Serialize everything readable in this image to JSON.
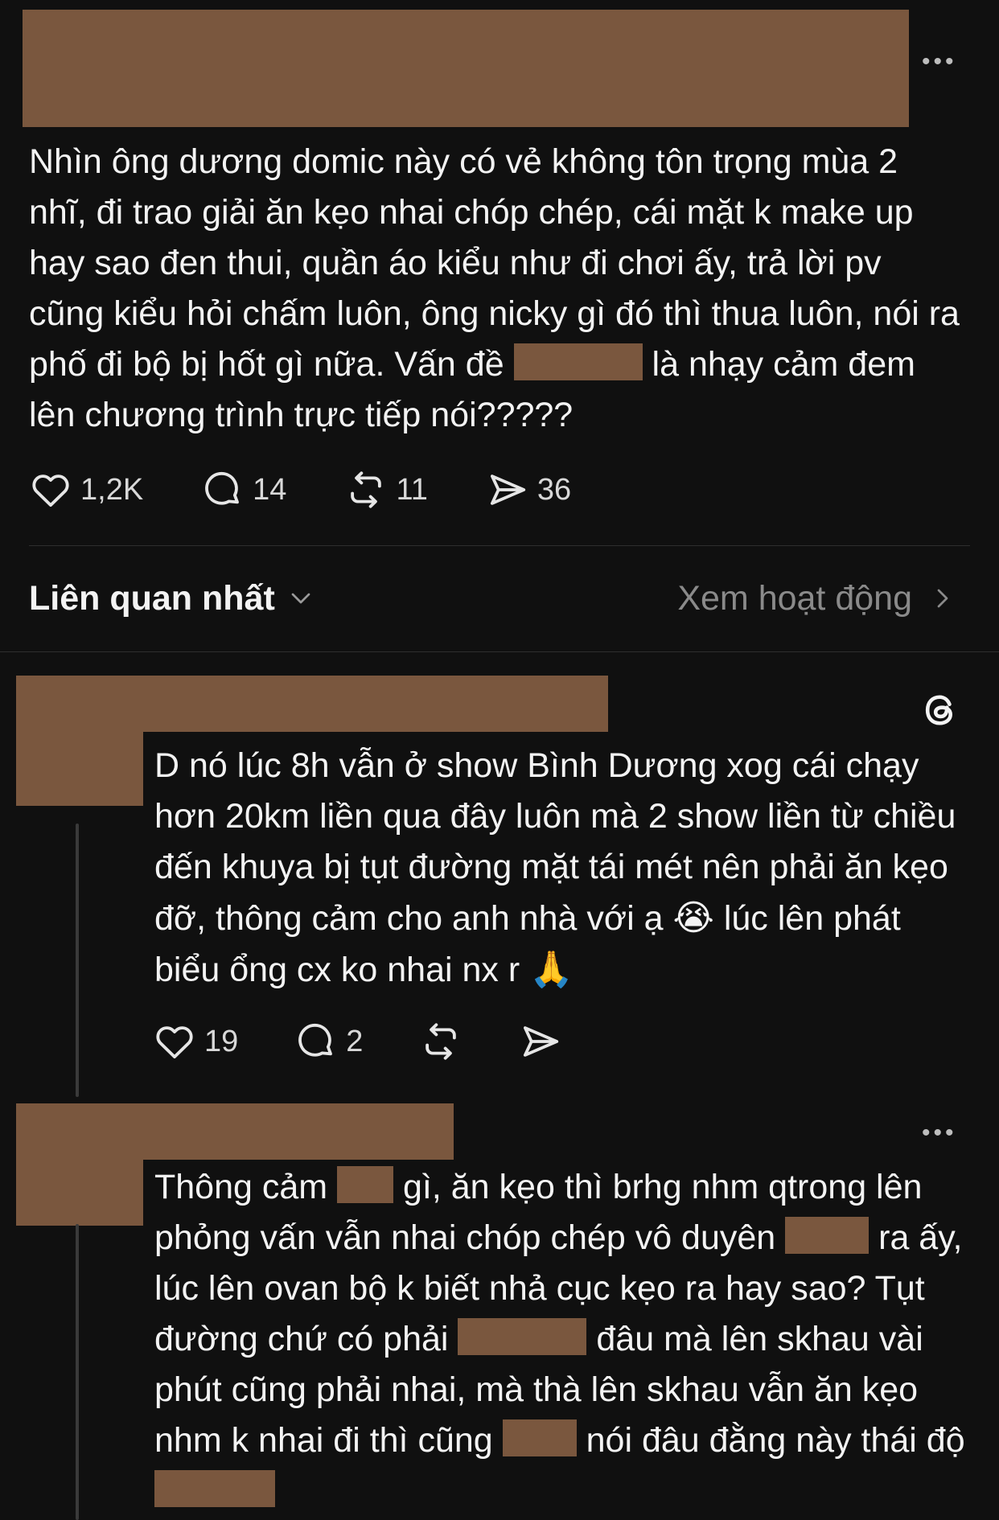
{
  "post": {
    "text_parts": [
      "Nhìn ông dương domic này có vẻ không tôn trọng mùa 2 nhĩ, đi trao giải ăn kẹo nhai chóp chép, cái mặt k make up hay sao đen thui, quần áo kiểu như đi chơi ấy, trả lời pv cũng kiểu hỏi chấm luôn, ông nicky gì đó thì thua luôn, nói ra phố đi bộ bị hốt gì nữa. Vấn đề ",
      " là nhạy cảm đem lên chương trình trực tiếp nói?????"
    ],
    "more_label": "•••",
    "likes": "1,2K",
    "comments": "14",
    "reposts": "11",
    "shares": "36"
  },
  "sort": {
    "label": "Liên quan nhất",
    "activity_label": "Xem hoạt động"
  },
  "reply1": {
    "text": "D nó lúc 8h vẫn ở show Bình Dương xog cái chạy hơn 20km liền qua đây luôn mà 2 show liền từ chiều đến khuya bị tụt đường mặt tái mét nên phải ăn kẹo đỡ, thông cảm cho anh nhà với ạ",
    "emoji1": "😭",
    "text2": "lúc lên phát biểu ổng cx ko nhai nx r",
    "emoji2": "🙏",
    "likes": "19",
    "comments": "2"
  },
  "reply2": {
    "more_label": "•••",
    "parts": [
      "Thông cảm",
      "gì, ăn kẹo thì brhg nhm qtrong lên phỏng vấn vẫn nhai chóp chép vô duyên",
      "ra ấy, lúc lên ovan bộ k biết nhả cục kẹo ra hay sao? Tụt đường chứ có phải",
      "đâu mà lên skhau vài phút cũng phải nhai, mà thà lên skhau vẫn ăn kẹo nhm k nhai đi thì cũng",
      "nói đâu đằng này thái độ"
    ]
  }
}
